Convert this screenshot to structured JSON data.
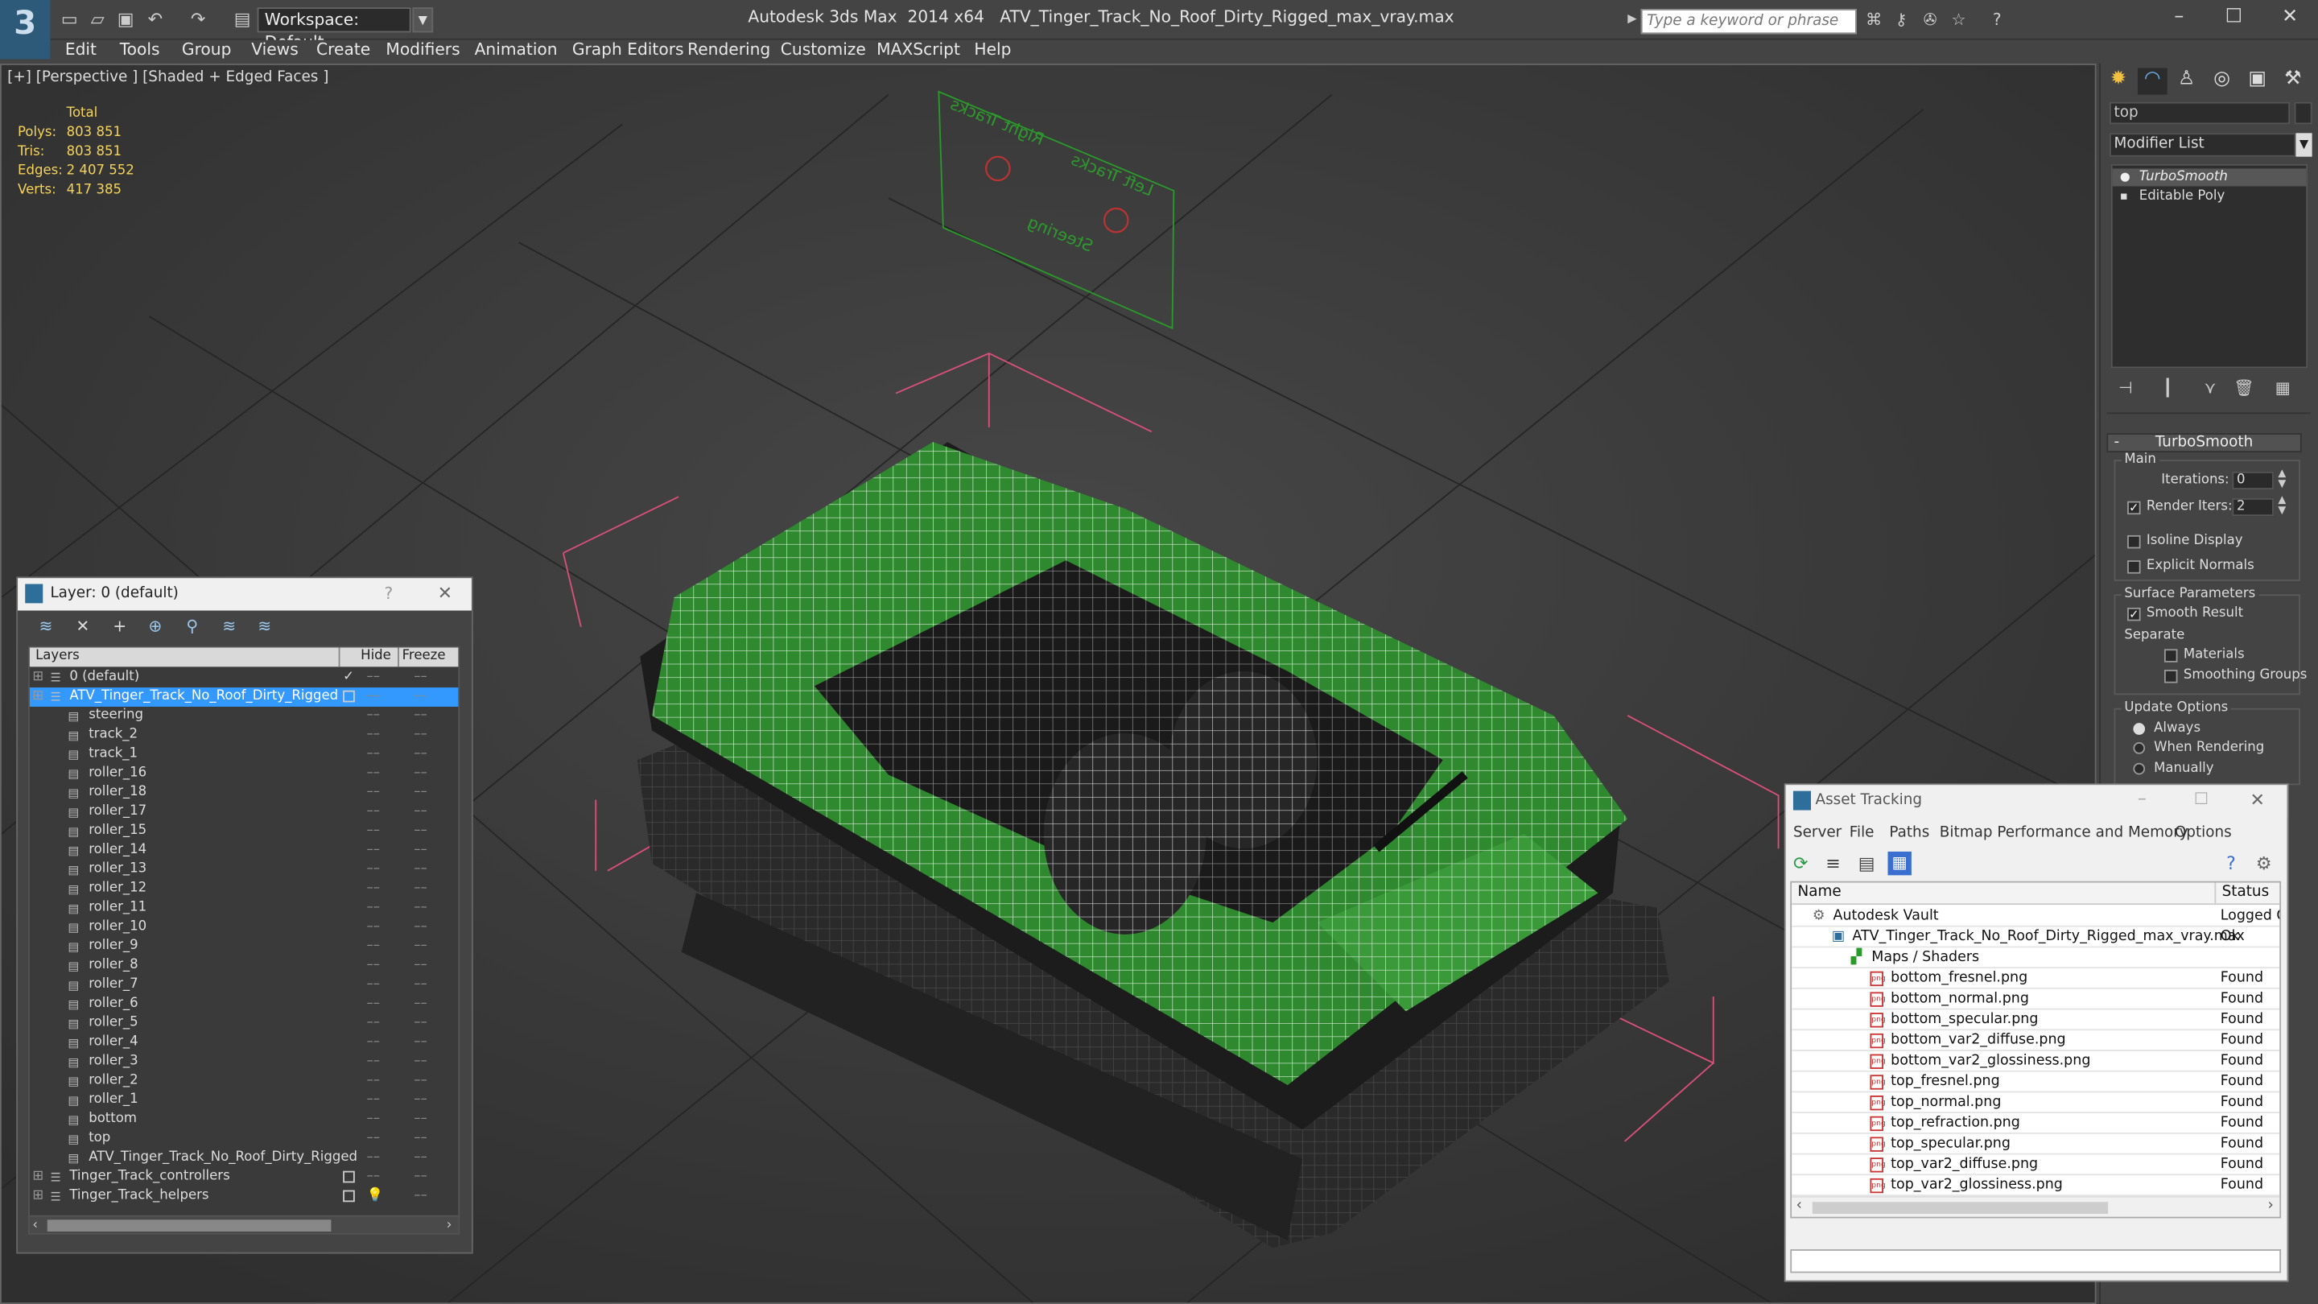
{
  "app": {
    "title_app": "Autodesk 3ds Max  2014 x64",
    "title_file": "ATV_Tinger_Track_No_Roof_Dirty_Rigged_max_vray.max",
    "workspace": "Workspace: Default",
    "search_placeholder": "Type a keyword or phrase"
  },
  "menu": [
    "Edit",
    "Tools",
    "Group",
    "Views",
    "Create",
    "Modifiers",
    "Animation",
    "Graph Editors",
    "Rendering",
    "Customize",
    "MAXScript",
    "Help"
  ],
  "viewport": {
    "label": "[+] [Perspective ] [Shaded + Edged Faces ]",
    "stats": {
      "header": "Total",
      "rows": [
        {
          "label": "Polys:",
          "value": "803 851"
        },
        {
          "label": "Tris:",
          "value": "803 851"
        },
        {
          "label": "Edges:",
          "value": "2 407 552"
        },
        {
          "label": "Verts:",
          "value": "417 385"
        }
      ]
    },
    "sign": {
      "right": "Right Tracks",
      "left": "Left Tracks",
      "steering": "Steering"
    }
  },
  "command_panel": {
    "search": "top",
    "modifier_list": "Modifier List",
    "stack": [
      "TurboSmooth",
      "Editable Poly"
    ],
    "turbosmooth": {
      "title": "TurboSmooth",
      "main": "Main",
      "iterations_label": "Iterations:",
      "iterations_value": "0",
      "render_iters_label": "Render Iters:",
      "render_iters_value": "2",
      "isoline": "Isoline Display",
      "explicit": "Explicit Normals",
      "surface_params": "Surface Parameters",
      "smooth_result": "Smooth Result",
      "separate": "Separate",
      "materials": "Materials",
      "smoothing_groups": "Smoothing Groups",
      "update_options": "Update Options",
      "always": "Always",
      "when_rendering": "When Rendering",
      "manually": "Manually"
    }
  },
  "layer_panel": {
    "title": "Layer: 0 (default)",
    "help": "?",
    "col_layers": "Layers",
    "col_hide": "Hide",
    "col_freeze": "Freeze",
    "rows": [
      {
        "name": "0 (default)",
        "indent": 0
      },
      {
        "name": "ATV_Tinger_Track_No_Roof_Dirty_Rigged",
        "indent": 0
      },
      {
        "name": "steering",
        "indent": 1
      },
      {
        "name": "track_2",
        "indent": 1
      },
      {
        "name": "track_1",
        "indent": 1
      },
      {
        "name": "roller_16",
        "indent": 1
      },
      {
        "name": "roller_18",
        "indent": 1
      },
      {
        "name": "roller_17",
        "indent": 1
      },
      {
        "name": "roller_15",
        "indent": 1
      },
      {
        "name": "roller_14",
        "indent": 1
      },
      {
        "name": "roller_13",
        "indent": 1
      },
      {
        "name": "roller_12",
        "indent": 1
      },
      {
        "name": "roller_11",
        "indent": 1
      },
      {
        "name": "roller_10",
        "indent": 1
      },
      {
        "name": "roller_9",
        "indent": 1
      },
      {
        "name": "roller_8",
        "indent": 1
      },
      {
        "name": "roller_7",
        "indent": 1
      },
      {
        "name": "roller_6",
        "indent": 1
      },
      {
        "name": "roller_5",
        "indent": 1
      },
      {
        "name": "roller_4",
        "indent": 1
      },
      {
        "name": "roller_3",
        "indent": 1
      },
      {
        "name": "roller_2",
        "indent": 1
      },
      {
        "name": "roller_1",
        "indent": 1
      },
      {
        "name": "bottom",
        "indent": 1
      },
      {
        "name": "top",
        "indent": 1
      },
      {
        "name": "ATV_Tinger_Track_No_Roof_Dirty_Rigged",
        "indent": 1
      },
      {
        "name": "Tinger_Track_controllers",
        "indent": 0
      },
      {
        "name": "Tinger_Track_helpers",
        "indent": 0
      }
    ]
  },
  "asset_tracking": {
    "title": "Asset Tracking",
    "menu": [
      "Server",
      "File",
      "Paths",
      "Bitmap Performance and Memory",
      "Options"
    ],
    "col_name": "Name",
    "col_status": "Status",
    "rows": [
      {
        "name": "Autodesk Vault",
        "status": "Logged O",
        "indent": 0
      },
      {
        "name": "ATV_Tinger_Track_No_Roof_Dirty_Rigged_max_vray.max",
        "status": "Ok",
        "indent": 1
      },
      {
        "name": "Maps / Shaders",
        "status": "",
        "indent": 2
      },
      {
        "name": "bottom_fresnel.png",
        "status": "Found",
        "indent": 3
      },
      {
        "name": "bottom_normal.png",
        "status": "Found",
        "indent": 3
      },
      {
        "name": "bottom_specular.png",
        "status": "Found",
        "indent": 3
      },
      {
        "name": "bottom_var2_diffuse.png",
        "status": "Found",
        "indent": 3
      },
      {
        "name": "bottom_var2_glossiness.png",
        "status": "Found",
        "indent": 3
      },
      {
        "name": "top_fresnel.png",
        "status": "Found",
        "indent": 3
      },
      {
        "name": "top_normal.png",
        "status": "Found",
        "indent": 3
      },
      {
        "name": "top_refraction.png",
        "status": "Found",
        "indent": 3
      },
      {
        "name": "top_specular.png",
        "status": "Found",
        "indent": 3
      },
      {
        "name": "top_var2_diffuse.png",
        "status": "Found",
        "indent": 3
      },
      {
        "name": "top_var2_glossiness.png",
        "status": "Found",
        "indent": 3
      }
    ]
  },
  "colors": {
    "accent": "#3399ff",
    "wire_green": "#2e8b2e",
    "stat_yellow": "#f5d35a",
    "bbox_pink": "#d9507a"
  }
}
